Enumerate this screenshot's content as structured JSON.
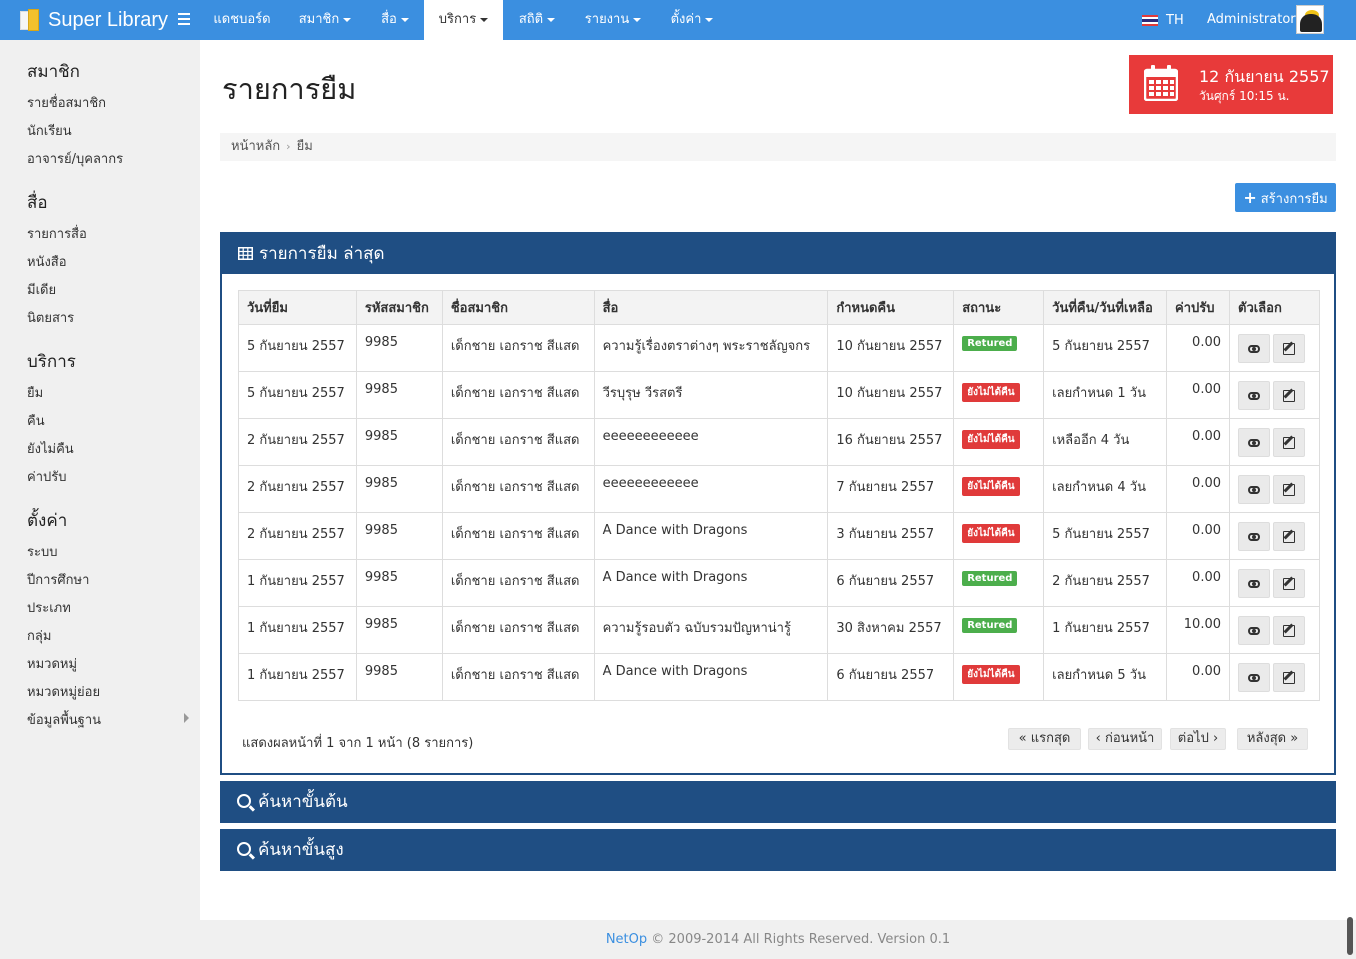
{
  "app": {
    "title": "Super Library",
    "accent": "#3b8fe0",
    "panel_color": "#1f4e83",
    "alert_color": "#e83a3a"
  },
  "nav": {
    "items": [
      "แดชบอร์ด",
      "สมาชิก",
      "สื่อ",
      "บริการ",
      "สถิติ",
      "รายงาน",
      "ตั้งค่า"
    ],
    "active": "บริการ",
    "lang": "TH",
    "user": "Administrator"
  },
  "sidebar": {
    "sections": [
      {
        "heading": "สมาชิก",
        "items": [
          "รายชื่อสมาชิก",
          "นักเรียน",
          "อาจารย์/บุคลากร"
        ]
      },
      {
        "heading": "สื่อ",
        "items": [
          "รายการสื่อ",
          "หนังสือ",
          "มีเดีย",
          "นิตยสาร"
        ]
      },
      {
        "heading": "บริการ",
        "items": [
          "ยืม",
          "คืน",
          "ยังไม่คืน",
          "ค่าปรับ"
        ]
      },
      {
        "heading": "ตั้งค่า",
        "items": [
          "ระบบ",
          "ปีการศึกษา",
          "ประเภท",
          "กลุ่ม",
          "หมวดหมู่",
          "หมวดหมู่ย่อย",
          "ข้อมูลพื้นฐาน"
        ]
      }
    ]
  },
  "page": {
    "title": "รายการยืม",
    "date": "12 กันยายน 2557",
    "day_time": "วันศุกร์  10:15 น.",
    "breadcrumb": [
      "หน้าหลัก",
      "ยืม"
    ],
    "create_button": "สร้างการยืม"
  },
  "panel": {
    "title": "รายการยืม ล่าสุด",
    "columns": [
      "วันที่ยืม",
      "รหัสสมาชิก",
      "ชื่อสมาชิก",
      "สื่อ",
      "กำหนดคืน",
      "สถานะ",
      "วันที่คืน/วันที่เหลือ",
      "ค่าปรับ",
      "ตัวเลือก"
    ],
    "rows": [
      [
        "5 กันยายน 2557",
        "9985",
        "เด็กชาย เอกราช สีแสด",
        "ความรู้เรื่องตราต่างๆ พระราชลัญจกร",
        "10 กันยายน 2557",
        "Retured",
        "5 กันยายน 2557",
        "0.00"
      ],
      [
        "5 กันยายน 2557",
        "9985",
        "เด็กชาย เอกราช สีแสด",
        "วีรบุรุษ วีรสตรี",
        "10 กันยายน 2557",
        "ยังไม่ได้คืน",
        "เลยกำหนด 1 วัน",
        "0.00"
      ],
      [
        "2 กันยายน 2557",
        "9985",
        "เด็กชาย เอกราช สีแสด",
        "eeeeeeeeeeee",
        "16 กันยายน 2557",
        "ยังไม่ได้คืน",
        "เหลืออีก 4 วัน",
        "0.00"
      ],
      [
        "2 กันยายน 2557",
        "9985",
        "เด็กชาย เอกราช สีแสด",
        "eeeeeeeeeeee",
        "7 กันยายน 2557",
        "ยังไม่ได้คืน",
        "เลยกำหนด 4 วัน",
        "0.00"
      ],
      [
        "2 กันยายน 2557",
        "9985",
        "เด็กชาย เอกราช สีแสด",
        "A Dance with Dragons",
        "3 กันยายน 2557",
        "ยังไม่ได้คืน",
        "5 กันยายน 2557",
        "0.00"
      ],
      [
        "1 กันยายน 2557",
        "9985",
        "เด็กชาย เอกราช สีแสด",
        "A Dance with Dragons",
        "6 กันยายน 2557",
        "Retured",
        "2 กันยายน 2557",
        "0.00"
      ],
      [
        "1 กันยายน 2557",
        "9985",
        "เด็กชาย เอกราช สีแสด",
        "ความรู้รอบตัว ฉบับรวมปัญหาน่ารู้",
        "30 สิงหาคม 2557",
        "Retured",
        "1 กันยายน 2557",
        "10.00"
      ],
      [
        "1 กันยายน 2557",
        "9985",
        "เด็กชาย เอกราช สีแสด",
        "A Dance with Dragons",
        "6 กันยายน 2557",
        "ยังไม่ได้คืน",
        "เลยกำหนด 5 วัน",
        "0.00"
      ]
    ],
    "status_colors": {
      "Retured": "#4cae4c",
      "ยังไม่ได้คืน": "#e03a3a"
    },
    "pager_info": "แสดงผลหน้าที่ 1 จาก 1 หน้า (8 รายการ)",
    "pager": {
      "first": "แรกสุด",
      "prev": "ก่อนหน้า",
      "next": "ต่อไป",
      "last": "หลังสุด"
    }
  },
  "search": {
    "basic": "ค้นหาขั้นต้น",
    "advanced": "ค้นหาขั้นสูง"
  },
  "footer": {
    "brand": "NetOp",
    "text": "© 2009-2014 All Rights Reserved. Version 0.1"
  }
}
